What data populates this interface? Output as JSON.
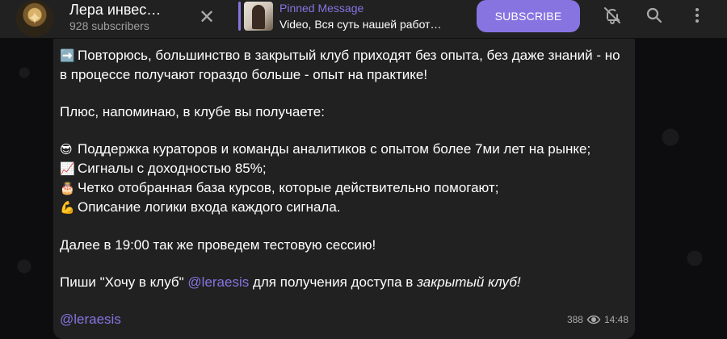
{
  "header": {
    "channel_title": "Лера инвес…",
    "subscribers": "928 subscribers",
    "pinned_label": "Pinned Message",
    "pinned_text": "Video, Вся суть нашей работ…",
    "subscribe_label": "SUBSCRIBE",
    "icons": {
      "close": "close-icon",
      "mute": "bell-off-icon",
      "search": "search-icon",
      "menu": "more-vertical-icon"
    }
  },
  "message": {
    "line1_emoji": "➡️",
    "line1": "Повторюсь, большинство в закрытый клуб приходят без опыта, без даже знаний - но в процессе получают гораздо больше - опыт на практике!",
    "line2": "Плюс, напоминаю, в клубе вы получаете:",
    "bullets": [
      {
        "emoji": "😎",
        "text": "Поддержка кураторов и команды аналитиков с опытом более 7ми лет на рынке;"
      },
      {
        "emoji": "📈",
        "text": "Сигналы с доходностью 85%;"
      },
      {
        "emoji": "🎂",
        "text": "Четко отобранная база курсов, которые действительно помогают;"
      },
      {
        "emoji": "💪",
        "text": "Описание логики входа каждого сигнала."
      }
    ],
    "line3": "Далее в 19:00 так же проведем тестовую сессию!",
    "line4_pre": "Пиши \"Хочу в клуб\" ",
    "line4_link": "@leraesis",
    "line4_mid": " для получения доступа в ",
    "line4_italic": "закрытый клуб!",
    "signature_link": "@leraesis",
    "views": "388",
    "time": "14:48"
  },
  "colors": {
    "accent": "#8774e1",
    "header_bg": "#212121",
    "bubble_bg": "#212121",
    "muted_text": "#aaaaaa"
  }
}
